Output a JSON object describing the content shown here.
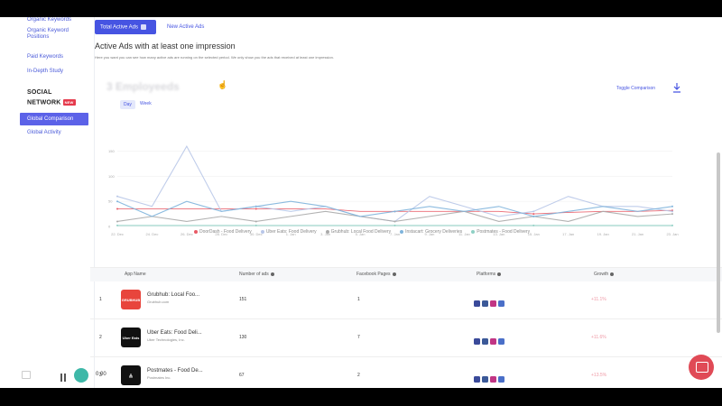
{
  "sidebar": {
    "links_top": [
      "Organic Keywords",
      "Organic Keyword Positions",
      "Paid Keywords",
      "In-Depth Study"
    ],
    "section_title_line1": "SOCIAL",
    "section_title_line2": "NETWORK",
    "new_badge": "NEW",
    "active_item": "Global Comparison",
    "after_active": "Global Activity"
  },
  "tabs": {
    "total": "Total Active Ads",
    "new": "New Active Ads"
  },
  "section": {
    "title": "Active Ads with at least one impression",
    "description": "Here you want you can see how many active ads are running on the selected period. We only show you the ads that received at least one impression."
  },
  "chart_heading": "3 Employeeds",
  "toggle_label": "Toggle Comparison",
  "range": {
    "day": "Day",
    "week": "Week"
  },
  "chart_data": {
    "type": "line",
    "x": [
      "22. Dec",
      "24. Dec",
      "26. Dec",
      "28. Dec",
      "30. Dec",
      "1. Jan",
      "3. Jan",
      "5. Jan",
      "7. Jan",
      "9. Jan",
      "11. Jan",
      "13. Jan",
      "15. Jan",
      "17. Jan",
      "19. Jan",
      "21. Jan",
      "23. Jan"
    ],
    "y_ticks": [
      "0",
      "50",
      "100",
      "150"
    ],
    "ylim": [
      0,
      180
    ],
    "series": [
      {
        "name": "DoorDash - Food Delivery",
        "color": "#e85a65",
        "values": [
          35,
          35,
          35,
          35,
          35,
          35,
          35,
          30,
          30,
          30,
          30,
          30,
          25,
          28,
          30,
          30,
          32
        ]
      },
      {
        "name": "Uber Eats: Food Delivery",
        "color": "#b8c6e8",
        "values": [
          60,
          40,
          160,
          30,
          40,
          30,
          40,
          20,
          10,
          60,
          40,
          20,
          30,
          60,
          40,
          40,
          30
        ]
      },
      {
        "name": "Grubhub: Local Food Delivery",
        "color": "#aaaaaa",
        "values": [
          10,
          20,
          10,
          20,
          10,
          20,
          30,
          20,
          10,
          20,
          30,
          10,
          20,
          10,
          30,
          20,
          25
        ]
      },
      {
        "name": "Instacart: Grocery Deliveries",
        "color": "#7fb4dc",
        "values": [
          50,
          20,
          50,
          30,
          40,
          50,
          40,
          20,
          30,
          40,
          30,
          40,
          20,
          30,
          40,
          30,
          40
        ]
      },
      {
        "name": "Postmates - Food Delivery",
        "color": "#8fd0c4",
        "values": [
          2,
          2,
          2,
          2,
          2,
          2,
          2,
          2,
          2,
          2,
          2,
          2,
          2,
          2,
          2,
          2,
          2
        ]
      }
    ]
  },
  "table": {
    "headers": [
      "App Name",
      "Number of ads",
      "Facebook Pages",
      "Platforms",
      "Growth"
    ],
    "rows": [
      {
        "rank": "1",
        "name": "Grubhub: Local Foo...",
        "developer": "Grubhub.com",
        "ads": "151",
        "pages": "1",
        "growth": "+11.1%",
        "logo_color": "#e8453c",
        "logo_text": "GRUBHUB"
      },
      {
        "rank": "2",
        "name": "Uber Eats: Food Deli...",
        "developer": "Uber Technologies, Inc.",
        "ads": "130",
        "pages": "7",
        "growth": "+11.6%",
        "logo_color": "#111111",
        "logo_text": "Uber Eats"
      },
      {
        "rank": "3",
        "name": "Postmates - Food De...",
        "developer": "Postmates Inc.",
        "ads": "67",
        "pages": "2",
        "growth": "+13.5%",
        "logo_color": "#111111",
        "logo_text": "⁂"
      }
    ],
    "platform_colors": [
      "#3a4a9a",
      "#3b5998",
      "#c13584",
      "#4a6fc8"
    ]
  },
  "player": {
    "time": "0:00"
  }
}
